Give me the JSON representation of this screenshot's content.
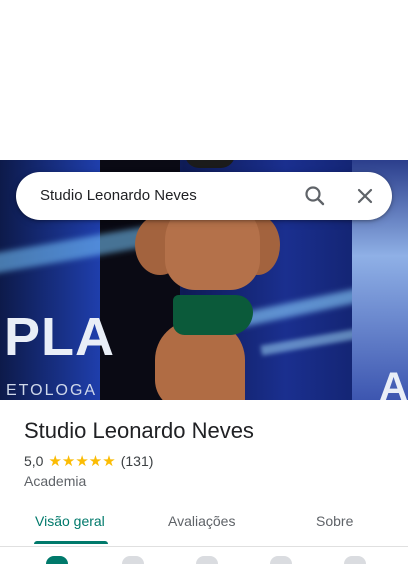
{
  "search": {
    "query": "Studio Leonardo Neves",
    "search_icon": "search-icon",
    "close_icon": "close-icon"
  },
  "hero": {
    "banner_text": "PLA",
    "banner_sub": "ETOLOGA",
    "banner_right": "A"
  },
  "place": {
    "name": "Studio Leonardo Neves",
    "rating": "5,0",
    "stars": "★★★★★",
    "review_count": "(131)",
    "category": "Academia"
  },
  "tabs": [
    {
      "label": "Visão geral",
      "active": true
    },
    {
      "label": "Avaliações",
      "active": false
    },
    {
      "label": "Sobre",
      "active": false
    }
  ],
  "colors": {
    "accent": "#00796b",
    "star": "#fbbc04"
  }
}
